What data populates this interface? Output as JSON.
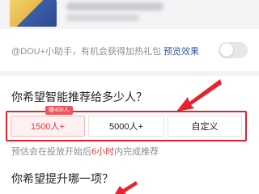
{
  "mention": {
    "prefix": "@DOU+小助手，有机会获得加热礼包",
    "preview_link": "预览效果"
  },
  "question1": "你希望智能推荐给多少人？",
  "options": {
    "badge": "曝400人",
    "items": [
      "1500人+",
      "5000人+",
      "自定义"
    ],
    "selected_index": 0
  },
  "estimate": {
    "before": "预估会在投放开始后",
    "highlight": "6小时",
    "after": "内完成推荐"
  },
  "question2": "你希望提升哪一项？",
  "colors": {
    "accent_red": "#e8222b",
    "link_blue": "#3a5b9c",
    "muted_gray": "#8a8f99"
  }
}
